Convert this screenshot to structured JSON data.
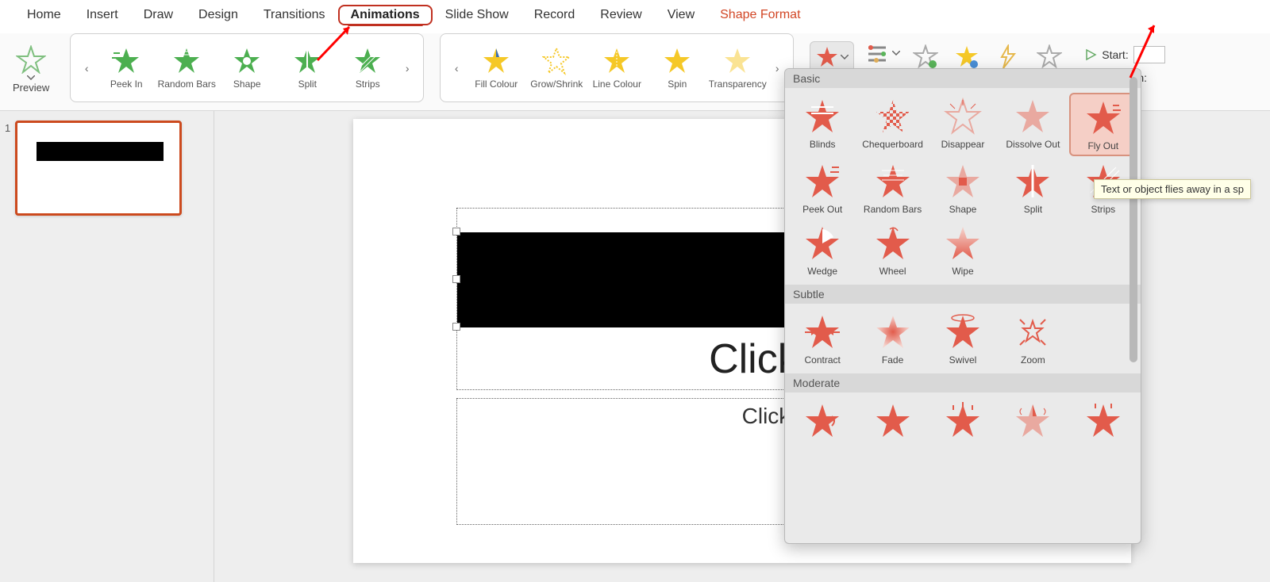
{
  "ribbon": {
    "tabs": [
      "Home",
      "Insert",
      "Draw",
      "Design",
      "Transitions",
      "Animations",
      "Slide Show",
      "Record",
      "Review",
      "View",
      "Shape Format"
    ],
    "active_tab": "Animations",
    "contextual_tab": "Shape Format"
  },
  "preview_label": "Preview",
  "gallery_green": {
    "items": [
      "Peek In",
      "Random Bars",
      "Shape",
      "Split",
      "Strips"
    ]
  },
  "gallery_yellow": {
    "items": [
      "Fill Colour",
      "Grow/Shrink",
      "Line Colour",
      "Spin",
      "Transparency"
    ]
  },
  "timing": {
    "start_label": "Start:",
    "duration_label": "Duration:"
  },
  "slide_panel": {
    "slide_number": "1"
  },
  "canvas": {
    "title_placeholder": "Click to a",
    "subtitle_placeholder": "Click to ad"
  },
  "dropdown": {
    "sections": {
      "basic": {
        "header": "Basic",
        "items": [
          "Blinds",
          "Chequerboard",
          "Disappear",
          "Dissolve Out",
          "Fly Out",
          "Peek Out",
          "Random Bars",
          "Shape",
          "Split",
          "Strips",
          "Wedge",
          "Wheel",
          "Wipe"
        ],
        "selected": "Fly Out"
      },
      "subtle": {
        "header": "Subtle",
        "items": [
          "Contract",
          "Fade",
          "Swivel",
          "Zoom"
        ]
      },
      "moderate": {
        "header": "Moderate",
        "items": [
          "",
          "",
          "",
          "",
          ""
        ]
      }
    }
  },
  "tooltip_text": "Text or object flies away in a sp"
}
